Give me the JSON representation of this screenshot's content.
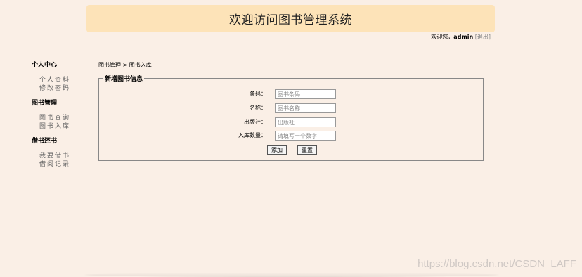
{
  "header": {
    "title": "欢迎访问图书管理系统"
  },
  "welcome": {
    "prefix": "欢迎您，",
    "user": "admin",
    "logout": "[退出]"
  },
  "sidebar": {
    "groups": [
      {
        "heading": "个人中心",
        "items": [
          {
            "label": "个人资料"
          },
          {
            "label": "修改密码"
          }
        ]
      },
      {
        "heading": "图书管理",
        "items": [
          {
            "label": "图书查询"
          },
          {
            "label": "图书入库"
          }
        ]
      },
      {
        "heading": "借书还书",
        "items": [
          {
            "label": "我要借书"
          },
          {
            "label": "借阅记录"
          }
        ]
      }
    ]
  },
  "breadcrumb": "图书管理 > 图书入库",
  "form": {
    "legend": "新增图书信息",
    "fields": [
      {
        "label": "条码：",
        "value": "",
        "placeholder": "图书条码"
      },
      {
        "label": "名称：",
        "value": "",
        "placeholder": "图书名称"
      },
      {
        "label": "出版社：",
        "value": "",
        "placeholder": "出版社"
      },
      {
        "label": "入库数量：",
        "value": "",
        "placeholder": "请填写一个数字"
      }
    ],
    "submit_label": "添加",
    "reset_label": "重置"
  },
  "watermark": "https://blog.csdn.net/CSDN_LAFF",
  "colors": {
    "background": "#faefe6",
    "header": "#fde3b8"
  }
}
